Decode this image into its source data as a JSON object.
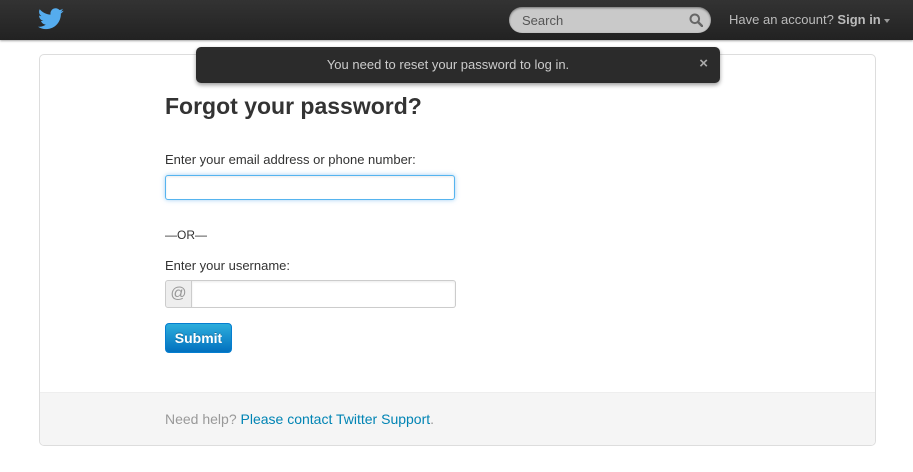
{
  "header": {
    "logo_icon": "twitter-bird-icon",
    "search": {
      "placeholder": "Search",
      "icon": "search-icon"
    },
    "account": {
      "prompt": "Have an account?",
      "signin_label": "Sign in",
      "caret_icon": "caret-down-icon"
    }
  },
  "notice": {
    "message": "You need to reset your password to log in.",
    "close_label": "×"
  },
  "form": {
    "title": "Forgot your password?",
    "email_label": "Enter your email address or phone number:",
    "email_value": "",
    "or_text": "—OR—",
    "username_label": "Enter your username:",
    "username_prefix": "@",
    "username_value": "",
    "submit_label": "Submit"
  },
  "footer": {
    "help_text": "Need help?",
    "link_text": "Please contact Twitter Support",
    "period": "."
  },
  "colors": {
    "topbar": "#222222",
    "link": "#0084b4",
    "button": "#0271bf",
    "twitter_blue": "#55acee"
  }
}
